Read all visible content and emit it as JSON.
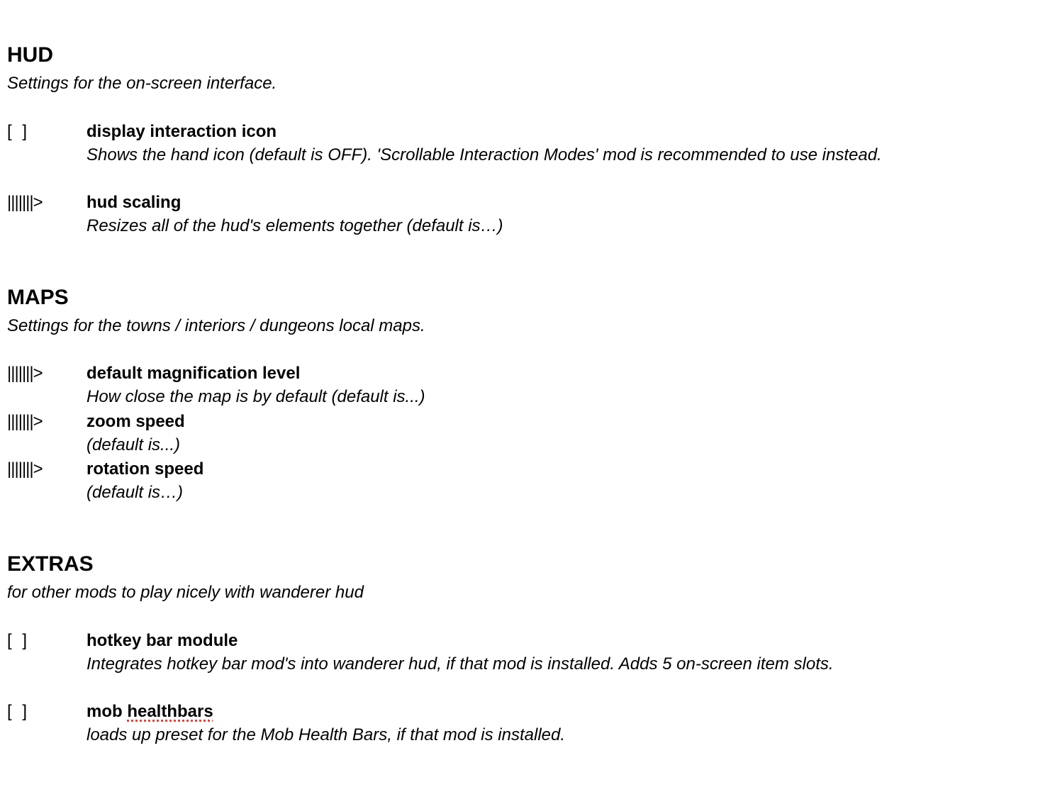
{
  "hud": {
    "title": "HUD",
    "description": "Settings for the on-screen interface.",
    "settings": [
      {
        "control": "[ ]",
        "control_type": "checkbox",
        "name": "display interaction icon",
        "description": "Shows the hand icon (default is OFF). 'Scrollable Interaction Modes' mod is recommended to use instead."
      },
      {
        "control": "|||||||>",
        "control_type": "slider",
        "name": "hud scaling",
        "description": "Resizes all of the hud's elements together (default is…)"
      }
    ]
  },
  "maps": {
    "title": "MAPS",
    "description": "Settings for the towns / interiors / dungeons local maps.",
    "settings": [
      {
        "control": "|||||||>",
        "control_type": "slider",
        "name": "default magnification level",
        "description": "How close the map is by default (default is...)"
      },
      {
        "control": "|||||||>",
        "control_type": "slider",
        "name": "zoom speed",
        "description": "(default is...)"
      },
      {
        "control": "|||||||>",
        "control_type": "slider",
        "name": "rotation speed",
        "description": "(default is…)"
      }
    ]
  },
  "extras": {
    "title": "EXTRAS",
    "description": "for other mods to play nicely with wanderer hud",
    "settings": [
      {
        "control": "[ ]",
        "control_type": "checkbox",
        "name": "hotkey bar module",
        "description": "Integrates hotkey bar mod's into wanderer hud, if that mod is installed. Adds 5 on-screen item slots."
      },
      {
        "control": "[ ]",
        "control_type": "checkbox",
        "name_prefix": "mob ",
        "name_flagged": "healthbars",
        "description": "loads up preset for the Mob Health Bars, if that mod is installed."
      }
    ]
  },
  "colors": {
    "text": "#000000",
    "background": "#ffffff",
    "spellcheck_underline": "#e0443a"
  }
}
